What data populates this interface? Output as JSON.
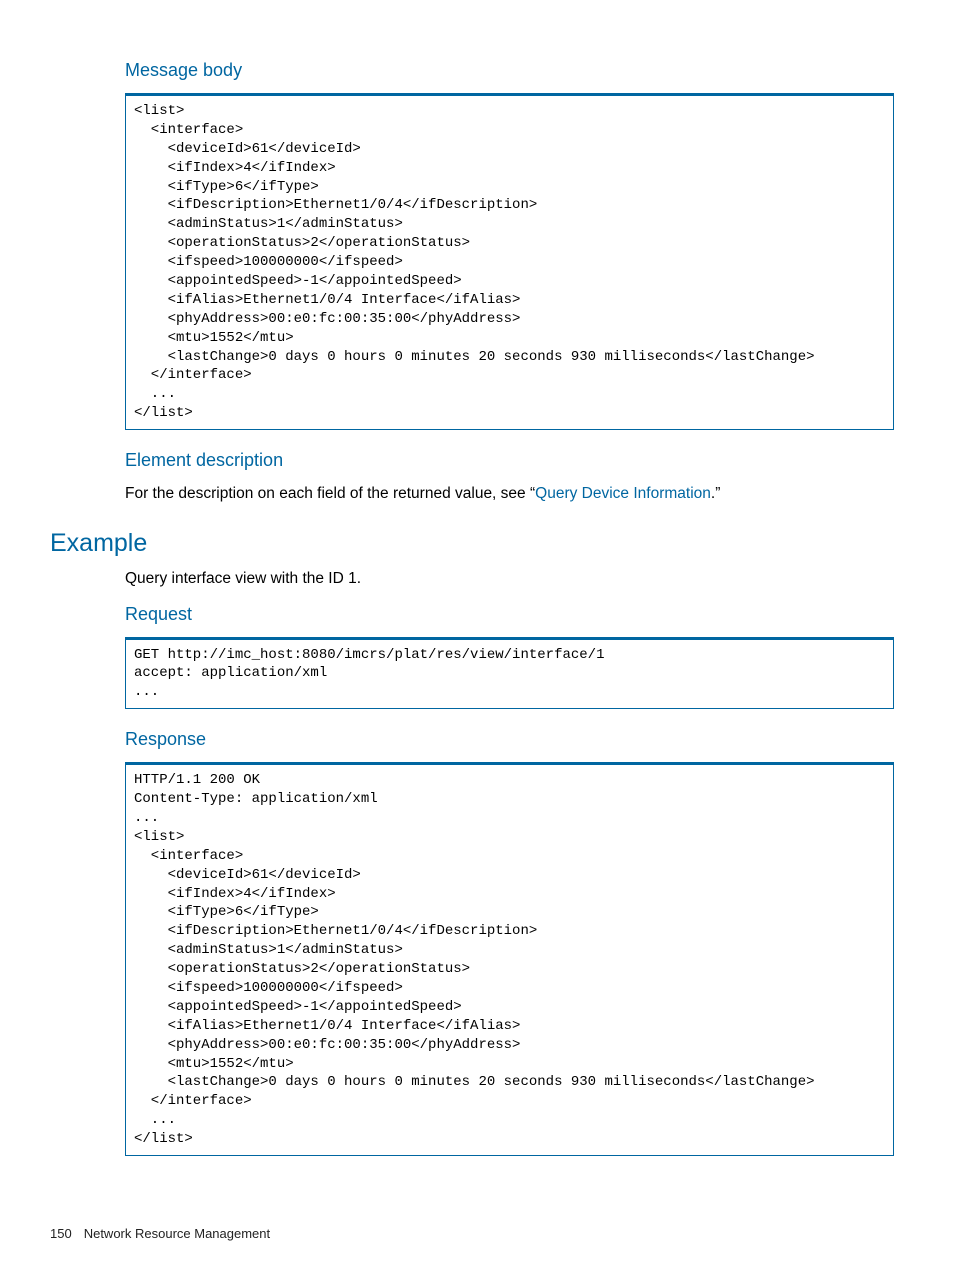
{
  "sections": {
    "messageBody": {
      "title": "Message body",
      "code": "<list>\n  <interface>\n    <deviceId>61</deviceId>\n    <ifIndex>4</ifIndex>\n    <ifType>6</ifType>\n    <ifDescription>Ethernet1/0/4</ifDescription>\n    <adminStatus>1</adminStatus>\n    <operationStatus>2</operationStatus>\n    <ifspeed>100000000</ifspeed>\n    <appointedSpeed>-1</appointedSpeed>\n    <ifAlias>Ethernet1/0/4 Interface</ifAlias>\n    <phyAddress>00:e0:fc:00:35:00</phyAddress>\n    <mtu>1552</mtu>\n    <lastChange>0 days 0 hours 0 minutes 20 seconds 930 milliseconds</lastChange>\n  </interface>\n  ...\n</list>"
    },
    "elementDescription": {
      "title": "Element description",
      "textPrefix": "For the description on each field of the returned value, see “",
      "linkText": "Query Device Information",
      "textSuffix": ".”"
    },
    "example": {
      "title": "Example",
      "intro": "Query interface view with the ID 1."
    },
    "request": {
      "title": "Request",
      "code": "GET http://imc_host:8080/imcrs/plat/res/view/interface/1\naccept: application/xml\n..."
    },
    "response": {
      "title": "Response",
      "code": "HTTP/1.1 200 OK\nContent-Type: application/xml\n...\n<list>\n  <interface>\n    <deviceId>61</deviceId>\n    <ifIndex>4</ifIndex>\n    <ifType>6</ifType>\n    <ifDescription>Ethernet1/0/4</ifDescription>\n    <adminStatus>1</adminStatus>\n    <operationStatus>2</operationStatus>\n    <ifspeed>100000000</ifspeed>\n    <appointedSpeed>-1</appointedSpeed>\n    <ifAlias>Ethernet1/0/4 Interface</ifAlias>\n    <phyAddress>00:e0:fc:00:35:00</phyAddress>\n    <mtu>1552</mtu>\n    <lastChange>0 days 0 hours 0 minutes 20 seconds 930 milliseconds</lastChange>\n  </interface>\n  ...\n</list>"
    }
  },
  "footer": {
    "pageNumber": "150",
    "chapter": "Network Resource Management"
  }
}
